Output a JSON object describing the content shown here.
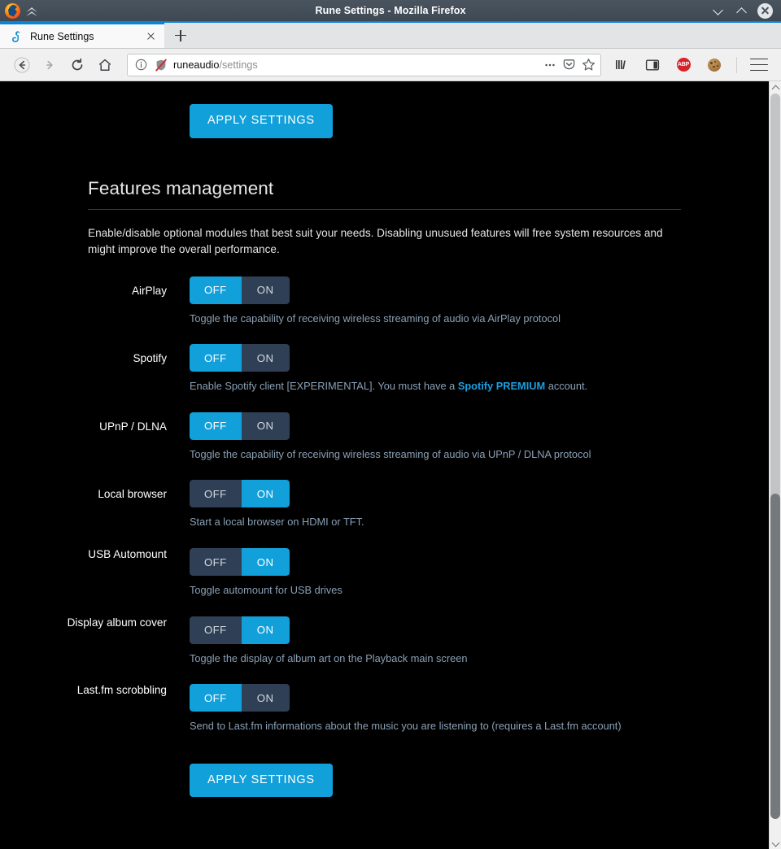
{
  "window": {
    "title": "Rune Settings - Mozilla Firefox",
    "minimize_label": "Minimize",
    "maximize_label": "Maximize",
    "close_label": "Close"
  },
  "tabs": [
    {
      "title": "Rune Settings",
      "favicon": "runeaudio-icon",
      "close_label": "Close tab"
    }
  ],
  "newtab": {
    "label": "New tab"
  },
  "nav": {
    "back_label": "Back",
    "forward_label": "Forward",
    "reload_label": "Reload",
    "home_label": "Home"
  },
  "urlbar": {
    "host": "runeaudio",
    "path": "/settings",
    "info_icon": "info-icon",
    "tracking_icon": "shield-crossed-icon",
    "page_actions_icon": "ellipsis-icon",
    "pocket_icon": "pocket-icon",
    "bookmark_icon": "star-icon"
  },
  "toolbar": {
    "library_icon": "library-icon",
    "sidebar_icon": "sidebar-icon",
    "adblock_label": "ABP",
    "cookie_icon": "cookie-icon",
    "menu_icon": "hamburger-icon"
  },
  "page": {
    "top_apply_label": "APPLY SETTINGS",
    "bottom_apply_label": "APPLY SETTINGS",
    "section_title": "Features management",
    "section_description": "Enable/disable optional modules that best suit your needs. Disabling unusued features will free system resources and might improve the overall performance.",
    "features": [
      {
        "label": "AirPlay",
        "off_label": "OFF",
        "on_label": "ON",
        "state": "OFF",
        "description": "Toggle the capability of receiving wireless streaming of audio via AirPlay protocol"
      },
      {
        "label": "Spotify",
        "off_label": "OFF",
        "on_label": "ON",
        "state": "OFF",
        "description_pre": "Enable Spotify client [EXPERIMENTAL]. You must have a ",
        "description_link": "Spotify PREMIUM",
        "description_post": " account."
      },
      {
        "label": "UPnP / DLNA",
        "off_label": "OFF",
        "on_label": "ON",
        "state": "OFF",
        "description": "Toggle the capability of receiving wireless streaming of audio via UPnP / DLNA protocol"
      },
      {
        "label": "Local browser",
        "off_label": "OFF",
        "on_label": "ON",
        "state": "ON",
        "description": "Start a local browser on HDMI or TFT."
      },
      {
        "label": "USB Automount",
        "off_label": "OFF",
        "on_label": "ON",
        "state": "ON",
        "description": "Toggle automount for USB drives"
      },
      {
        "label": "Display album cover",
        "off_label": "OFF",
        "on_label": "ON",
        "state": "ON",
        "description": "Toggle the display of album art on the Playback main screen"
      },
      {
        "label": "Last.fm scrobbling",
        "off_label": "OFF",
        "on_label": "ON",
        "state": "OFF",
        "description": "Send to Last.fm informations about the music you are listening to (requires a Last.fm account)"
      }
    ]
  },
  "colors": {
    "accent_blue": "#12a0db",
    "inactive_slate": "#2f4056",
    "page_background": "#000000",
    "description_text": "#8aa0b5",
    "link_blue": "#1a9fe0"
  }
}
